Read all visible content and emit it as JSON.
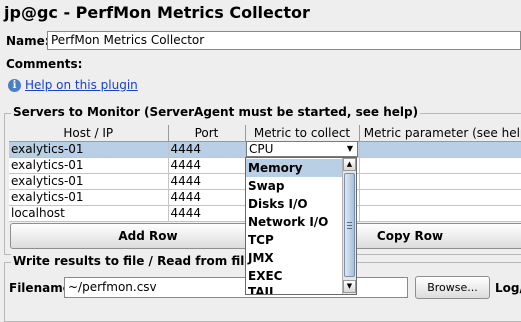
{
  "window": {
    "title": "jp@gc - PerfMon Metrics Collector"
  },
  "form": {
    "name_label": "Name:",
    "name_value": "PerfMon Metrics Collector",
    "comments_label": "Comments:",
    "help_link": "Help on this plugin",
    "help_icon": "info-icon"
  },
  "servers": {
    "title": "Servers to Monitor (ServerAgent must be started, see help)",
    "columns": [
      "Host / IP",
      "Port",
      "Metric to collect",
      "Metric parameter (see help)"
    ],
    "rows": [
      {
        "host": "exalytics-01",
        "port": "4444",
        "metric": "CPU",
        "param": ""
      },
      {
        "host": "exalytics-01",
        "port": "4444",
        "metric": "",
        "param": ""
      },
      {
        "host": "exalytics-01",
        "port": "4444",
        "metric": "",
        "param": ""
      },
      {
        "host": "exalytics-01",
        "port": "4444",
        "metric": "",
        "param": ""
      },
      {
        "host": "localhost",
        "port": "4444",
        "metric": "",
        "param": ""
      }
    ],
    "selected_row": 0,
    "combo_value": "CPU",
    "dropdown_options": [
      "Memory",
      "Swap",
      "Disks I/O",
      "Network I/O",
      "TCP",
      "JMX",
      "EXEC",
      "TAIL"
    ],
    "highlighted_option": "Memory",
    "add_row_label": "Add Row",
    "copy_row_label": "Copy Row"
  },
  "file": {
    "title": "Write results to file / Read from file",
    "filename_label": "Filename",
    "filename_value": "~/perfmon.csv",
    "browse_label": "Browse...",
    "log_label": "Log/"
  },
  "colors": {
    "selection": "#b8cfe5",
    "link": "#1a43c0",
    "background": "#eeeeee"
  }
}
